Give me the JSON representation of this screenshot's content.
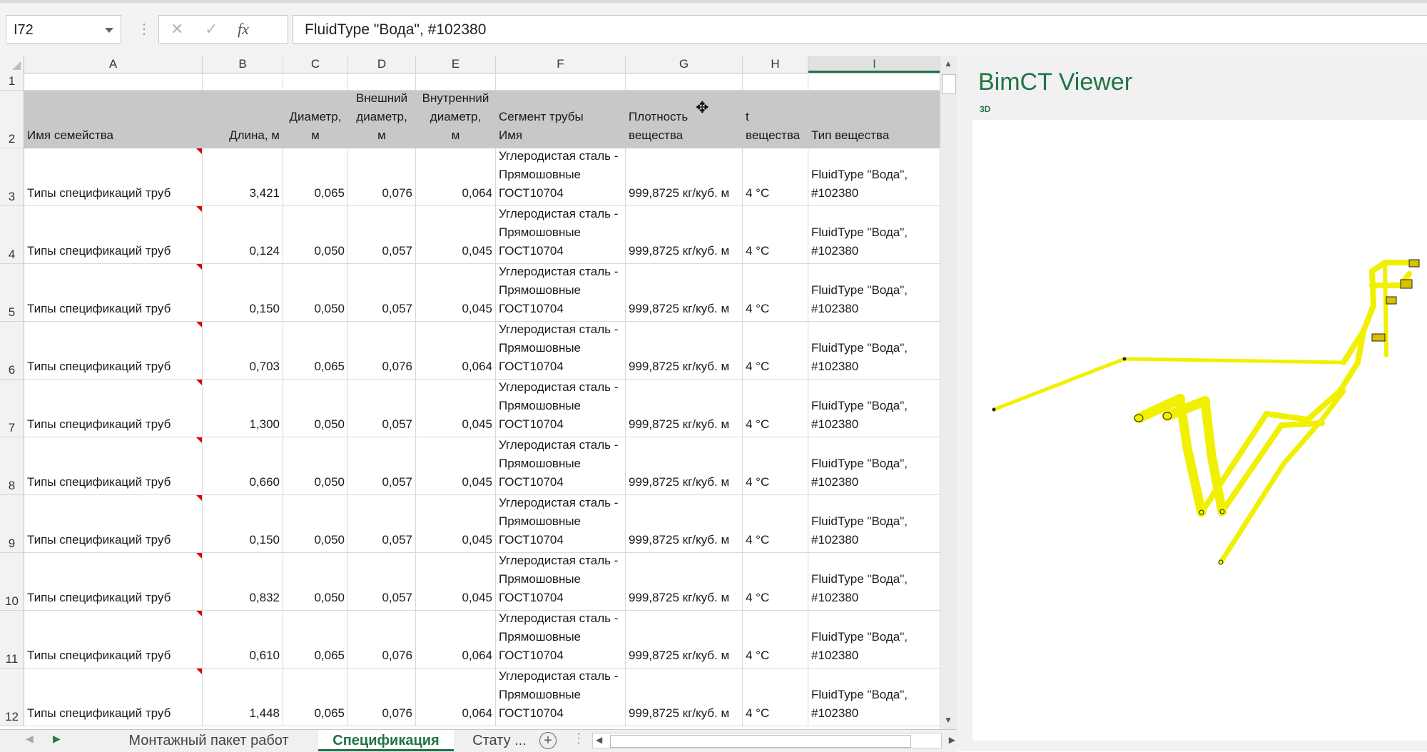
{
  "formula_bar": {
    "name_box": "I72",
    "cancel_glyph": "✕",
    "enter_glyph": "✓",
    "fx_glyph": "fx",
    "formula": "FluidType \"Вода\", #102380"
  },
  "columns": [
    "A",
    "B",
    "C",
    "D",
    "E",
    "F",
    "G",
    "H",
    "I"
  ],
  "selected_column": "I",
  "row_numbers": [
    "1",
    "2",
    "3",
    "4",
    "5",
    "6",
    "7",
    "8",
    "9",
    "10",
    "11",
    "12"
  ],
  "table_headers": [
    "Имя семейства",
    "Длина, м",
    "Диаметр,\nм",
    "Внешний\nдиаметр,\nм",
    "Внутренний\nдиаметр,\nм",
    "Сегмент трубы\nИмя",
    "Плотность\nвещества",
    "t\nвещества",
    "Тип вещества"
  ],
  "rows": [
    [
      "Типы спецификаций труб",
      "3,421",
      "0,065",
      "0,076",
      "0,064",
      "Углеродистая сталь -\nПрямошовные\nГОСТ10704",
      "999,8725 кг/куб. м",
      "4 °C",
      "FluidType \"Вода\",\n#102380"
    ],
    [
      "Типы спецификаций труб",
      "0,124",
      "0,050",
      "0,057",
      "0,045",
      "Углеродистая сталь -\nПрямошовные\nГОСТ10704",
      "999,8725 кг/куб. м",
      "4 °C",
      "FluidType \"Вода\",\n#102380"
    ],
    [
      "Типы спецификаций труб",
      "0,150",
      "0,050",
      "0,057",
      "0,045",
      "Углеродистая сталь -\nПрямошовные\nГОСТ10704",
      "999,8725 кг/куб. м",
      "4 °C",
      "FluidType \"Вода\",\n#102380"
    ],
    [
      "Типы спецификаций труб",
      "0,703",
      "0,065",
      "0,076",
      "0,064",
      "Углеродистая сталь -\nПрямошовные\nГОСТ10704",
      "999,8725 кг/куб. м",
      "4 °C",
      "FluidType \"Вода\",\n#102380"
    ],
    [
      "Типы спецификаций труб",
      "1,300",
      "0,050",
      "0,057",
      "0,045",
      "Углеродистая сталь -\nПрямошовные\nГОСТ10704",
      "999,8725 кг/куб. м",
      "4 °C",
      "FluidType \"Вода\",\n#102380"
    ],
    [
      "Типы спецификаций труб",
      "0,660",
      "0,050",
      "0,057",
      "0,045",
      "Углеродистая сталь -\nПрямошовные\nГОСТ10704",
      "999,8725 кг/куб. м",
      "4 °C",
      "FluidType \"Вода\",\n#102380"
    ],
    [
      "Типы спецификаций труб",
      "0,150",
      "0,050",
      "0,057",
      "0,045",
      "Углеродистая сталь -\nПрямошовные\nГОСТ10704",
      "999,8725 кг/куб. м",
      "4 °C",
      "FluidType \"Вода\",\n#102380"
    ],
    [
      "Типы спецификаций труб",
      "0,832",
      "0,050",
      "0,057",
      "0,045",
      "Углеродистая сталь -\nПрямошовные\nГОСТ10704",
      "999,8725 кг/куб. м",
      "4 °C",
      "FluidType \"Вода\",\n#102380"
    ],
    [
      "Типы спецификаций труб",
      "0,610",
      "0,065",
      "0,076",
      "0,064",
      "Углеродистая сталь -\nПрямошовные\nГОСТ10704",
      "999,8725 кг/куб. м",
      "4 °C",
      "FluidType \"Вода\",\n#102380"
    ],
    [
      "Типы спецификаций труб",
      "1,448",
      "0,065",
      "0,076",
      "0,064",
      "Углеродистая сталь -\nПрямошовные\nГОСТ10704",
      "999,8725 кг/куб. м",
      "4 °C",
      "FluidType \"Вода\",\n#102380"
    ]
  ],
  "sheet_tabs": [
    "Монтажный пакет работ",
    "Спецификация",
    "Стату ..."
  ],
  "active_tab": "Спецификация",
  "viewer": {
    "title": "BimCT Viewer",
    "mode": "3D"
  },
  "colors": {
    "accent": "#217346",
    "header_fill": "#c8c8c8",
    "pipe": "#f0f000",
    "comment_marker": "#e00000"
  }
}
